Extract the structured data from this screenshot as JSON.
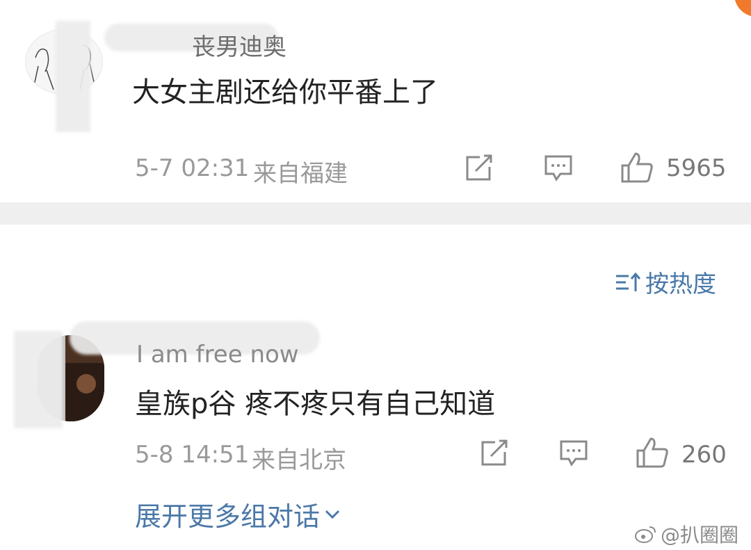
{
  "comments": [
    {
      "username": "丧男迪奥",
      "text": "大女主剧还给你平番上了",
      "time": "5-7 02:31",
      "location": "来自福建",
      "likes": "5965"
    },
    {
      "username": "I am free now",
      "text": "皇族p谷 疼不疼只有自己知道",
      "time": "5-8 14:51",
      "location": "来自北京",
      "likes": "260"
    }
  ],
  "sort_label": "按热度",
  "expand_label": "展开更多组对话",
  "watermark": "@扒圈圈",
  "colors": {
    "link": "#4a78a8",
    "meta": "#999999",
    "divider": "#efefef",
    "accent": "#f07a2b"
  },
  "icons": [
    "share-icon",
    "comment-icon",
    "like-icon",
    "sort-icon",
    "chevron-down-icon",
    "weibo-logo-icon"
  ]
}
